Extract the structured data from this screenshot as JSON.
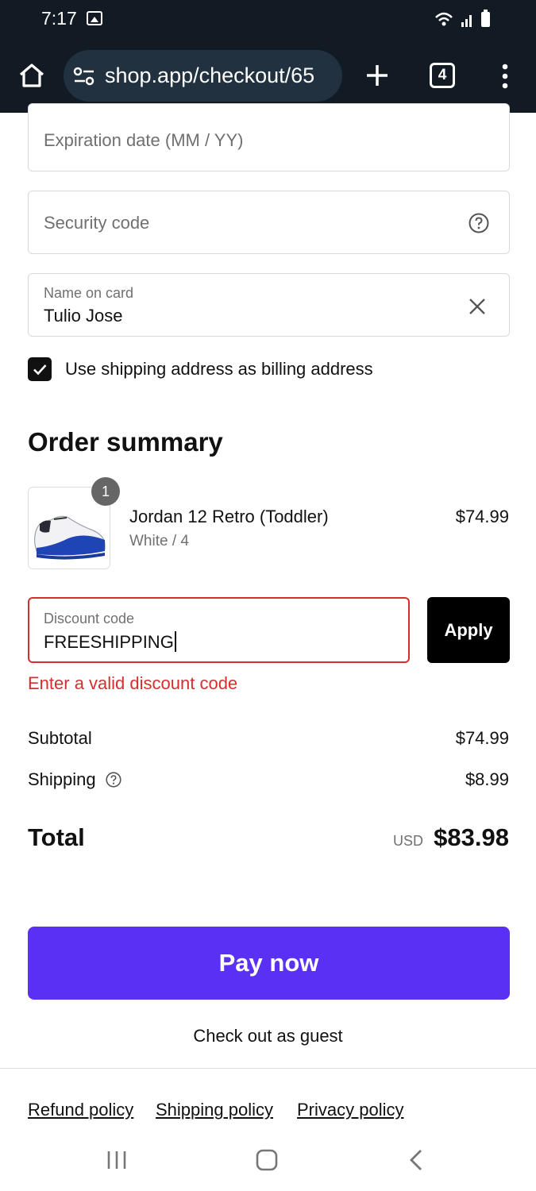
{
  "status_bar": {
    "time": "7:17"
  },
  "browser": {
    "url": "shop.app/checkout/65",
    "tab_count": "4"
  },
  "form": {
    "expiration": {
      "placeholder": "Expiration date (MM / YY)"
    },
    "security": {
      "placeholder": "Security code"
    },
    "name_on_card": {
      "label": "Name on card",
      "value": "Tulio Jose"
    },
    "billing_checkbox": {
      "label": "Use shipping address as billing address",
      "checked": true
    }
  },
  "order_summary": {
    "title": "Order summary",
    "items": [
      {
        "quantity": "1",
        "name": "Jordan 12 Retro (Toddler)",
        "variant": "White / 4",
        "price": "$74.99"
      }
    ],
    "discount": {
      "label": "Discount code",
      "value": "FREESHIPPING",
      "apply_label": "Apply",
      "error": "Enter a valid discount code"
    },
    "subtotal": {
      "label": "Subtotal",
      "value": "$74.99"
    },
    "shipping": {
      "label": "Shipping",
      "value": "$8.99"
    },
    "total": {
      "label": "Total",
      "currency": "USD",
      "value": "$83.98"
    }
  },
  "actions": {
    "pay_label": "Pay now",
    "guest_label": "Check out as guest"
  },
  "footer": {
    "links": [
      "Refund policy",
      "Shipping policy",
      "Privacy policy"
    ]
  },
  "colors": {
    "pay_button": "#5a31f4",
    "error": "#d32f2f",
    "chrome_bg": "#121a24",
    "url_bar_bg": "#22313f"
  }
}
